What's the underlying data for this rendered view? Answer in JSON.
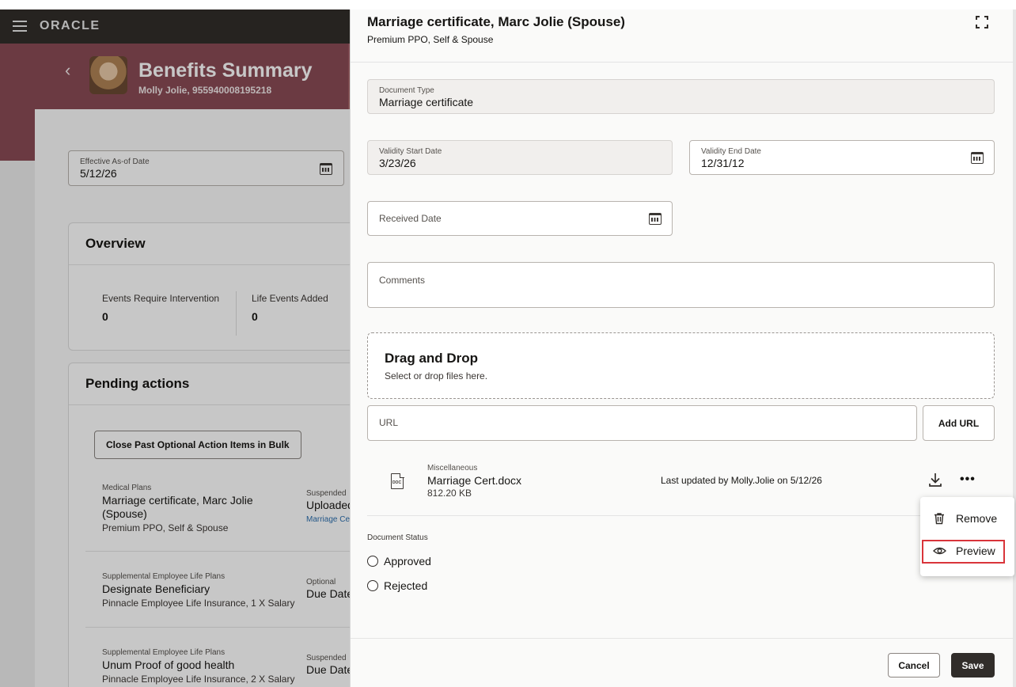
{
  "topbar": {
    "brand": "ORACLE"
  },
  "hero": {
    "title": "Benefits Summary",
    "subtitle": "Molly Jolie, 955940008195218"
  },
  "effective_date": {
    "label": "Effective As-of Date",
    "value": "5/12/26"
  },
  "overview": {
    "title": "Overview",
    "metrics": [
      {
        "label": "Events Require Intervention",
        "value": "0"
      },
      {
        "label": "Life Events Added",
        "value": "0"
      }
    ]
  },
  "pending": {
    "title": "Pending actions",
    "bulk_button": "Close Past Optional Action Items in Bulk",
    "items": [
      {
        "category": "Medical Plans",
        "title": "Marriage certificate, Marc Jolie (Spouse)",
        "subtitle": "Premium PPO, Self & Spouse",
        "status": "Suspended",
        "status_value": "Uploaded",
        "link": "Marriage Ce"
      },
      {
        "category": "Supplemental Employee Life Plans",
        "title": "Designate Beneficiary",
        "subtitle": "Pinnacle Employee Life Insurance, 1 X Salary",
        "status": "Optional",
        "status_value": "Due Date"
      },
      {
        "category": "Supplemental Employee Life Plans",
        "title": "Unum Proof of good health",
        "subtitle": "Pinnacle Employee Life Insurance, 2 X Salary",
        "status": "Suspended",
        "status_value": "Due Date"
      }
    ]
  },
  "drawer": {
    "title": "Marriage certificate, Marc Jolie (Spouse)",
    "subtitle": "Premium PPO, Self & Spouse",
    "document_type": {
      "label": "Document Type",
      "value": "Marriage certificate"
    },
    "validity_start": {
      "label": "Validity Start Date",
      "value": "3/23/26"
    },
    "validity_end": {
      "label": "Validity End Date",
      "value": "12/31/12"
    },
    "received_date": {
      "label": "Received Date"
    },
    "comments": {
      "label": "Comments"
    },
    "dropzone": {
      "title": "Drag and Drop",
      "subtitle": "Select or drop files here."
    },
    "url": {
      "label": "URL",
      "button": "Add URL"
    },
    "attachment": {
      "category": "Miscellaneous",
      "name": "Marriage Cert.docx",
      "size": "812.20 KB",
      "updated": "Last updated by Molly.Jolie on 5/12/26",
      "icon_text": "DOC"
    },
    "document_status": {
      "label": "Document Status",
      "options": [
        "Approved",
        "Rejected"
      ]
    },
    "cancel": "Cancel",
    "save": "Save"
  },
  "menu": {
    "items": [
      "Remove",
      "Preview"
    ]
  },
  "colors": {
    "accent": "#312d2a",
    "hero": "#8a4b55",
    "highlight": "#d9343a",
    "link": "#2c6fae"
  }
}
